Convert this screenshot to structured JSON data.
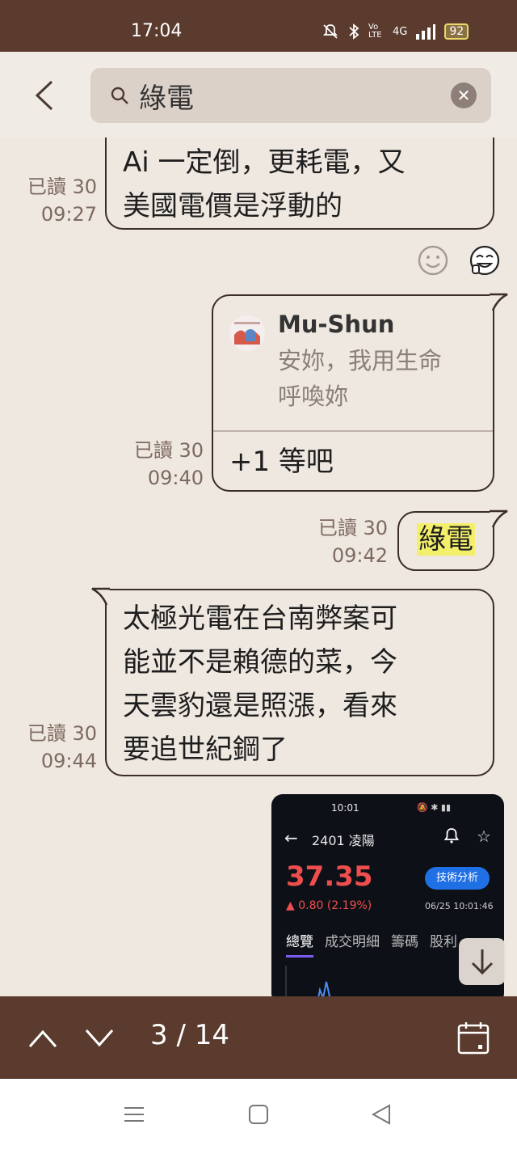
{
  "status_bar": {
    "time": "17:04",
    "network": "4G",
    "volte": "Vo LTE",
    "battery": "92"
  },
  "search": {
    "query": "綠電",
    "back_icon": "chevron-left-icon",
    "search_icon": "search-icon",
    "clear_icon": "close-icon"
  },
  "messages": [
    {
      "direction": "incoming",
      "lines": [
        "Ai 一定倒，更耗電，又",
        "美國電價是浮動的"
      ],
      "read": "已讀 30",
      "time": "09:27"
    },
    {
      "direction": "outgoing",
      "reply_to": {
        "author": "Mu-Shun",
        "quote_lines": [
          "安妳，我用生命",
          "呼喚妳"
        ]
      },
      "text": "+1 等吧",
      "read": "已讀 30",
      "time": "09:40"
    },
    {
      "direction": "outgoing",
      "text": "綠電",
      "highlighted": true,
      "read": "已讀 30",
      "time": "09:42"
    },
    {
      "direction": "incoming",
      "lines": [
        "太極光電在台南弊案可",
        "能並不是賴德的菜，今",
        "天雲豹還是照漲，看來",
        "要追世紀鋼了"
      ],
      "read": "已讀 30",
      "time": "09:44"
    }
  ],
  "stock_screenshot": {
    "time": "10:01",
    "title": "2401 凌陽",
    "price": "37.35",
    "change": "▲ 0.80 (2.19%)",
    "analysis_button": "技術分析",
    "date": "06/25 10:01:46",
    "tabs": [
      "總覽",
      "成交明細",
      "籌碼",
      "股利"
    ]
  },
  "bottom_bar": {
    "counter": "3 / 14",
    "up_icon": "chevron-up-icon",
    "down_icon": "chevron-down-icon",
    "calendar_icon": "calendar-icon"
  },
  "colors": {
    "header_brown": "#5a3b2e",
    "background": "#efe8e1",
    "highlight": "#f3ef6a",
    "stock_red": "#ef4e4e",
    "stock_blue": "#1f6fe5"
  }
}
